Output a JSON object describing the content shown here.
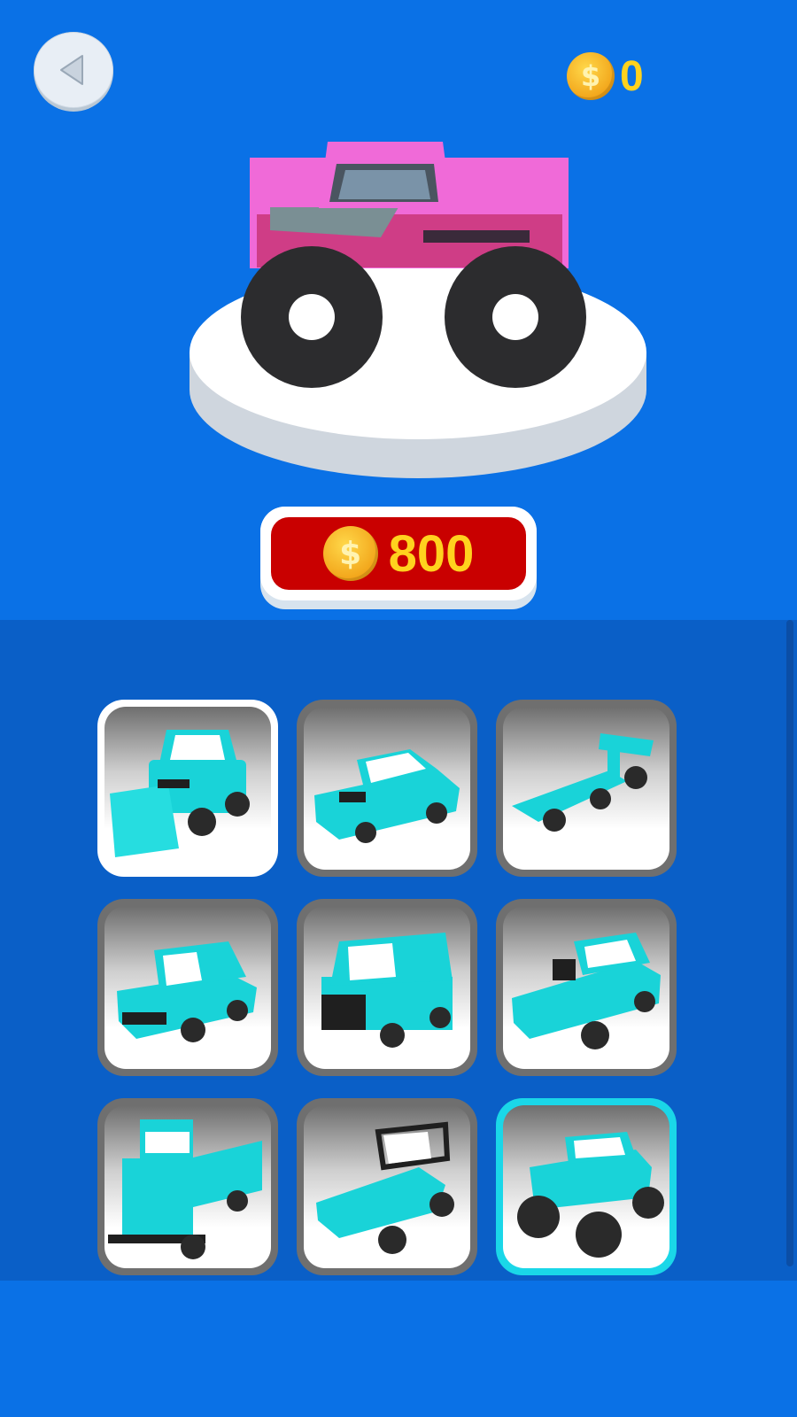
{
  "header": {
    "coins": "0",
    "coin_symbol": "$"
  },
  "price": {
    "coin_symbol": "$",
    "amount": "800"
  },
  "colors": {
    "background": "#0a71e6",
    "panel": "#0a5fc7",
    "price_button": "#c90000",
    "coin_text": "#ffd21e",
    "car_color": "#19d3d8",
    "preview_car": "#f06ad8"
  },
  "cars": [
    {
      "name": "plow-truck",
      "state": "selected"
    },
    {
      "name": "muscle-car",
      "state": "locked"
    },
    {
      "name": "formula-car",
      "state": "locked"
    },
    {
      "name": "suv",
      "state": "locked"
    },
    {
      "name": "jeep",
      "state": "locked"
    },
    {
      "name": "hot-rod",
      "state": "locked"
    },
    {
      "name": "dump-truck",
      "state": "locked"
    },
    {
      "name": "buggy",
      "state": "locked"
    },
    {
      "name": "monster-truck",
      "state": "active"
    }
  ]
}
